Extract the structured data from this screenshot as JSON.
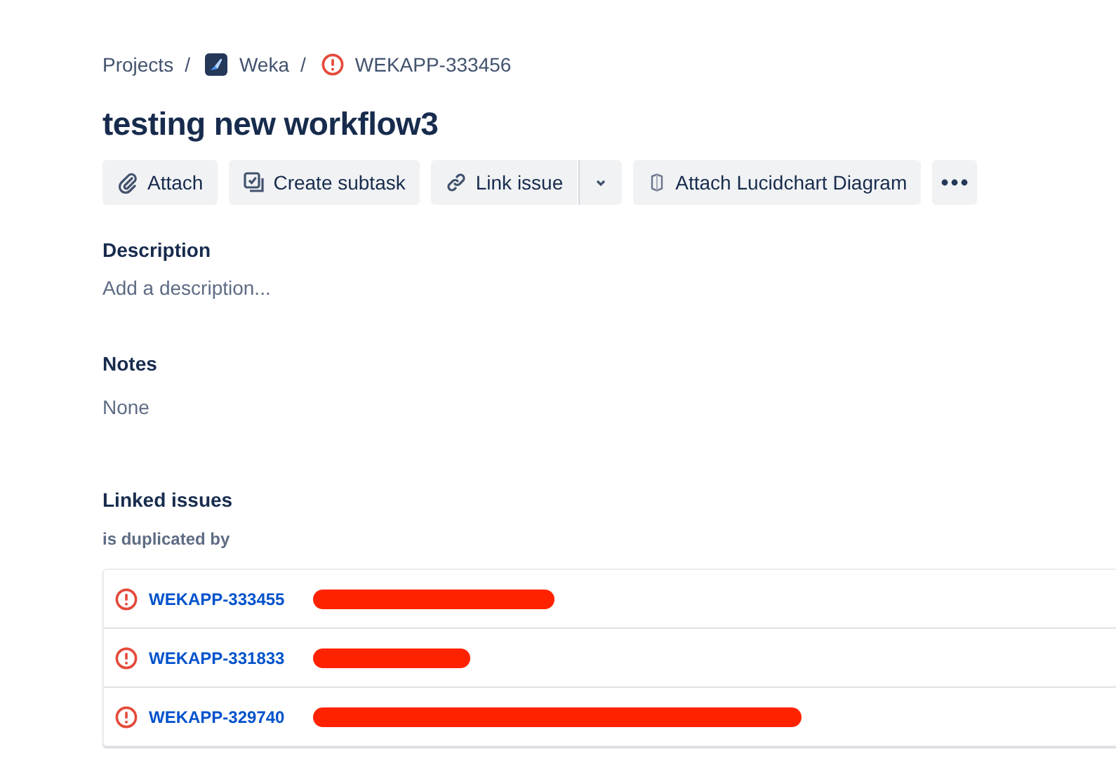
{
  "breadcrumbs": [
    {
      "label": "Projects",
      "kind": "text"
    },
    {
      "label": "Weka",
      "kind": "project",
      "separator": "/"
    },
    {
      "label": "WEKAPP-333456",
      "kind": "issue",
      "separator": "/"
    }
  ],
  "title": "testing new workflow3",
  "toolbar": [
    {
      "label": "Attach",
      "kind": "attach"
    },
    {
      "label": "Create subtask",
      "kind": "subtask"
    },
    {
      "label": "Link issue",
      "kind": "link"
    },
    {
      "kind": "dropdown"
    },
    {
      "label": "Attach Lucidchart Diagram",
      "kind": "lucid"
    },
    {
      "kind": "more"
    }
  ],
  "description": {
    "heading": "Description",
    "placeholder": "Add a description..."
  },
  "notes": {
    "heading": "Notes",
    "value": "None"
  },
  "linked_issues": {
    "heading": "Linked issues",
    "relation": "is duplicated by",
    "issues": [
      {
        "key": "WEKAPP-333455",
        "redacted": true
      },
      {
        "key": "WEKAPP-331833",
        "redacted": true
      },
      {
        "key": "WEKAPP-329740",
        "redacted": true
      }
    ]
  }
}
